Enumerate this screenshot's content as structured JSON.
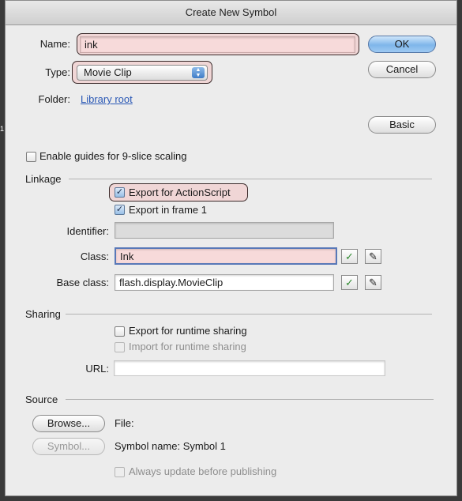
{
  "window": {
    "title": "Create New Symbol"
  },
  "general": {
    "name_label": "Name:",
    "name_value": "ink",
    "type_label": "Type:",
    "type_value": "Movie Clip",
    "folder_label": "Folder:",
    "folder_value": "Library root",
    "ok_label": "OK",
    "cancel_label": "Cancel",
    "basic_label": "Basic",
    "nine_slice_label": "Enable guides for 9-slice scaling",
    "nine_slice_checked": false
  },
  "linkage": {
    "title": "Linkage",
    "export_as_label": "Export for ActionScript",
    "export_as_checked": true,
    "export_frame1_label": "Export in frame 1",
    "export_frame1_checked": true,
    "identifier_label": "Identifier:",
    "identifier_value": "",
    "class_label": "Class:",
    "class_value": "Ink",
    "base_class_label": "Base class:",
    "base_class_value": "flash.display.MovieClip"
  },
  "sharing": {
    "title": "Sharing",
    "export_runtime_label": "Export for runtime sharing",
    "export_runtime_checked": false,
    "import_runtime_label": "Import for runtime sharing",
    "import_runtime_checked": false,
    "url_label": "URL:",
    "url_value": ""
  },
  "source": {
    "title": "Source",
    "browse_label": "Browse...",
    "file_label": "File:",
    "symbol_button_label": "Symbol...",
    "symbol_name_text": "Symbol name: Symbol 1",
    "always_update_label": "Always update before publishing",
    "always_update_checked": false
  },
  "icons": {
    "validate": "checkmark-icon",
    "edit": "pencil-icon"
  },
  "edge_fragment": "1"
}
